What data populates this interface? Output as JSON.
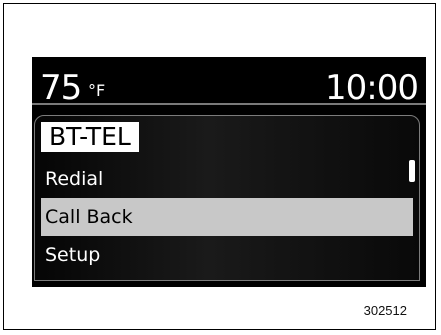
{
  "screen": {
    "temperature": "75",
    "temperature_unit": "°F",
    "time": "10:00",
    "menu": {
      "title": "BT-TEL",
      "items": [
        {
          "label": "Redial",
          "selected": false
        },
        {
          "label": "Call Back",
          "selected": true
        },
        {
          "label": "Setup",
          "selected": false
        }
      ]
    }
  },
  "figure": {
    "code": "302512"
  },
  "colors": {
    "screen_background": "#000000",
    "selected_background": "#c8c8c8",
    "text": "#ffffff"
  }
}
